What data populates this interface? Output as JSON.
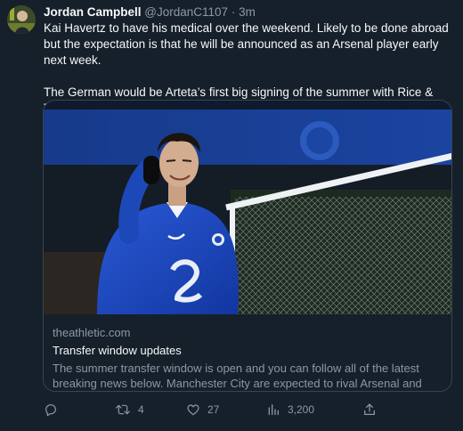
{
  "author": {
    "name": "Jordan Campbell",
    "handle": "@JordanC1107",
    "separator": "·",
    "time": "3m"
  },
  "tweet": {
    "paragraphs": [
      "Kai Havertz to have his medical over the weekend. Likely to be done abroad but the expectation is that he will be announced as an Arsenal player early next week.",
      "The German would be Arteta’s first big signing of the summer with Rice & Timber ongoing."
    ]
  },
  "card": {
    "image_icon": "football-player-photo",
    "domain": "theathletic.com",
    "title": "Transfer window updates",
    "description": "The summer transfer window is open and you can follow all of the latest breaking news below. Manchester City are expected to rival Arsenal and ma..."
  },
  "actions": {
    "reply": {
      "icon": "reply-icon",
      "count": ""
    },
    "retweet": {
      "icon": "retweet-icon",
      "count": "4"
    },
    "like": {
      "icon": "heart-icon",
      "count": "27"
    },
    "views": {
      "icon": "views-icon",
      "count": "3,200"
    },
    "share": {
      "icon": "share-icon",
      "count": ""
    }
  },
  "colors": {
    "background": "#15202b",
    "text": "#f7f9f9",
    "muted": "#8b98a5",
    "border": "#38444d",
    "chelsea_blue": "#1d49b8"
  }
}
